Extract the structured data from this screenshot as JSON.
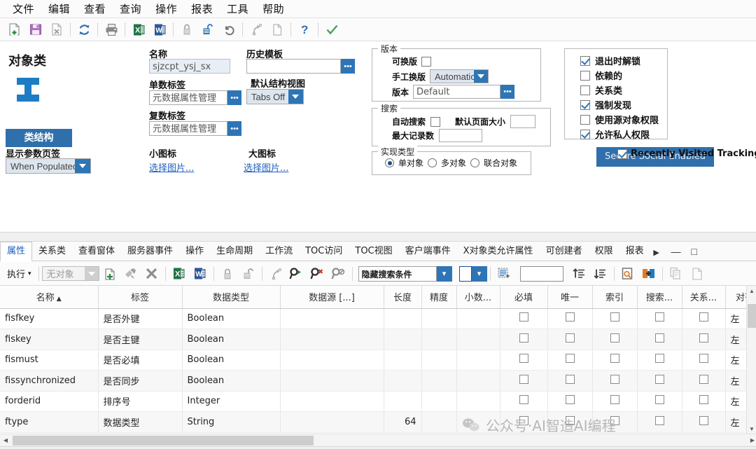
{
  "menubar": {
    "items": [
      {
        "label": "文件",
        "name": "menu-file"
      },
      {
        "label": "编辑",
        "name": "menu-edit"
      },
      {
        "label": "查看",
        "name": "menu-view"
      },
      {
        "label": "查询",
        "name": "menu-query"
      },
      {
        "label": "操作",
        "name": "menu-action"
      },
      {
        "label": "报表",
        "name": "menu-report"
      },
      {
        "label": "工具",
        "name": "menu-tools"
      },
      {
        "label": "帮助",
        "name": "menu-help"
      }
    ]
  },
  "toolbar": {
    "icons": [
      "new-document-icon",
      "save-icon",
      "delete-document-icon",
      "refresh-icon",
      "print-icon",
      "export-excel-icon",
      "export-word-icon",
      "lock-icon",
      "unlock-icon",
      "undo-icon",
      "redo-icon",
      "copy-page-icon",
      "help-icon",
      "apply-check-icon"
    ]
  },
  "left_panel": {
    "title": "对象类",
    "class_structure_button": "类结构",
    "show_param_tab_label": "显示参数页签",
    "show_param_tab_value": "When Populated"
  },
  "form": {
    "name_label": "名称",
    "name_value": "sjzcpt_ysj_sx",
    "singular_label": "单数标签",
    "singular_value": "元数据属性管理",
    "plural_label": "复数标签",
    "plural_value": "元数据属性管理",
    "small_icon_label": "小图标",
    "small_icon_link": "选择图片...",
    "large_icon_label": "大图标",
    "large_icon_link": "选择图片...",
    "history_template_label": "历史模板",
    "history_template_value": "",
    "default_structure_view_label": "默认结构视图",
    "default_structure_view_value": "Tabs Off"
  },
  "version_group": {
    "caption": "版本",
    "revisable_label": "可换版",
    "revisable_checked": false,
    "manual_revise_label": "手工换版",
    "manual_revise_value": "Automatic",
    "version_label": "版本",
    "version_value": "Default"
  },
  "search_group": {
    "caption": "搜索",
    "auto_search_label": "自动搜索",
    "auto_search_checked": false,
    "default_page_size_label": "默认页面大小",
    "default_page_size_value": "",
    "max_records_label": "最大记录数",
    "max_records_value": ""
  },
  "impl_group": {
    "caption": "实现类型",
    "options": [
      {
        "label": "单对象",
        "selected": true
      },
      {
        "label": "多对象",
        "selected": false
      },
      {
        "label": "联合对象",
        "selected": false
      }
    ]
  },
  "options_panel": {
    "items": [
      {
        "label": "退出时解锁",
        "checked": true,
        "name": "option-unlock-on-exit"
      },
      {
        "label": "依赖的",
        "checked": false,
        "name": "option-dependent"
      },
      {
        "label": "关系类",
        "checked": false,
        "name": "option-relationship-class"
      },
      {
        "label": "强制发现",
        "checked": true,
        "name": "option-force-discovery"
      },
      {
        "label": "使用源对象权限",
        "checked": false,
        "name": "option-use-source-permission"
      },
      {
        "label": "允许私人权限",
        "checked": true,
        "name": "option-allow-private-permission"
      }
    ]
  },
  "overlay": {
    "button_label": "Secure Social Enabled",
    "checkbox_label": "Recently Visited Tracking",
    "checkbox_checked": true
  },
  "tabs": {
    "items": [
      {
        "label": "属性",
        "active": true
      },
      {
        "label": "关系类",
        "active": false
      },
      {
        "label": "查看窗体",
        "active": false
      },
      {
        "label": "服务器事件",
        "active": false
      },
      {
        "label": "操作",
        "active": false
      },
      {
        "label": "生命周期",
        "active": false
      },
      {
        "label": "工作流",
        "active": false
      },
      {
        "label": "TOC访问",
        "active": false
      },
      {
        "label": "TOC视图",
        "active": false
      },
      {
        "label": "客户端事件",
        "active": false
      },
      {
        "label": "X对象类允许属性",
        "active": false
      },
      {
        "label": "可创建者",
        "active": false
      },
      {
        "label": "权限",
        "active": false
      },
      {
        "label": "报表",
        "active": false
      }
    ],
    "more_arrow": "▶",
    "minimize": "—",
    "maximize": "□"
  },
  "toolbar2": {
    "execute_label": "执行",
    "execute_caret": "▾",
    "object_select_value": "无对象",
    "search_condition_value": "隐藏搜索条件",
    "text_field_value": "",
    "icons": [
      "add-row-icon",
      "paste-special-icon",
      "delete-x-icon",
      "export-excel-icon",
      "export-word-icon",
      "lock-icon",
      "unlock-icon",
      "redo-icon",
      "find-run-icon",
      "find-delete-icon",
      "find-disable-icon",
      "select-block-icon",
      "indent-up-icon",
      "indent-down-icon",
      "zoom-find-icon",
      "add-column-icon",
      "copy-icon",
      "paste-icon"
    ]
  },
  "grid": {
    "columns": [
      {
        "label": "名称",
        "sort": "▲",
        "width": 140,
        "align": "left"
      },
      {
        "label": "标签",
        "sort": "",
        "width": 120,
        "align": "left"
      },
      {
        "label": "数据类型",
        "sort": "",
        "width": 140,
        "align": "left"
      },
      {
        "label": "数据源 [...]",
        "sort": "",
        "width": 148,
        "align": "left"
      },
      {
        "label": "长度",
        "sort": "",
        "width": 54,
        "align": "right"
      },
      {
        "label": "精度",
        "sort": "",
        "width": 50,
        "align": "right"
      },
      {
        "label": "小数...",
        "sort": "",
        "width": 62,
        "align": "right"
      },
      {
        "label": "必填",
        "sort": "",
        "width": 68,
        "align": "center"
      },
      {
        "label": "唯一",
        "sort": "",
        "width": 64,
        "align": "center"
      },
      {
        "label": "索引",
        "sort": "",
        "width": 64,
        "align": "center"
      },
      {
        "label": "搜索...",
        "sort": "",
        "width": 64,
        "align": "center"
      },
      {
        "label": "关系...",
        "sort": "",
        "width": 62,
        "align": "center"
      },
      {
        "label": "对齐",
        "sort": "",
        "width": 56,
        "align": "left"
      }
    ],
    "rows": [
      {
        "name": "fisfkey",
        "label": "是否外键",
        "datatype": "Boolean",
        "source": "",
        "length": "",
        "precision": "",
        "decimal": "",
        "required": false,
        "unique": false,
        "indexed": false,
        "searchable": false,
        "relation": false,
        "align": "左"
      },
      {
        "name": "fiskey",
        "label": "是否主键",
        "datatype": "Boolean",
        "source": "",
        "length": "",
        "precision": "",
        "decimal": "",
        "required": false,
        "unique": false,
        "indexed": false,
        "searchable": false,
        "relation": false,
        "align": "左"
      },
      {
        "name": "fismust",
        "label": "是否必填",
        "datatype": "Boolean",
        "source": "",
        "length": "",
        "precision": "",
        "decimal": "",
        "required": false,
        "unique": false,
        "indexed": false,
        "searchable": false,
        "relation": false,
        "align": "左"
      },
      {
        "name": "fissynchronized",
        "label": "是否同步",
        "datatype": "Boolean",
        "source": "",
        "length": "",
        "precision": "",
        "decimal": "",
        "required": false,
        "unique": false,
        "indexed": false,
        "searchable": false,
        "relation": false,
        "align": "左"
      },
      {
        "name": "forderid",
        "label": "排序号",
        "datatype": "Integer",
        "source": "",
        "length": "",
        "precision": "",
        "decimal": "",
        "required": false,
        "unique": false,
        "indexed": false,
        "searchable": false,
        "relation": false,
        "align": "左"
      },
      {
        "name": "ftype",
        "label": "数据类型",
        "datatype": "String",
        "source": "",
        "length": "64",
        "precision": "",
        "decimal": "",
        "required": false,
        "unique": false,
        "indexed": false,
        "searchable": false,
        "relation": false,
        "align": "左"
      }
    ]
  },
  "watermark": {
    "text": "公众号·AI智造AI编程"
  },
  "colors": {
    "accent_blue": "#2e75b6",
    "button_blue": "#2f6fac",
    "tab_active": "#1f5fbf"
  }
}
